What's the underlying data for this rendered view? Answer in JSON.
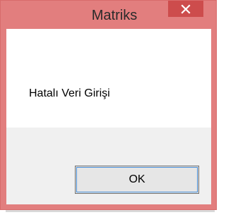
{
  "dialog": {
    "title": "Matriks",
    "message": "Hatalı Veri Girişi",
    "ok_label": "OK",
    "close_icon": "close-icon"
  },
  "colors": {
    "frame": "#e27e7e",
    "close_button": "#cd4c4c",
    "button_area": "#f0f0f0",
    "content_bg": "#ffffff"
  }
}
